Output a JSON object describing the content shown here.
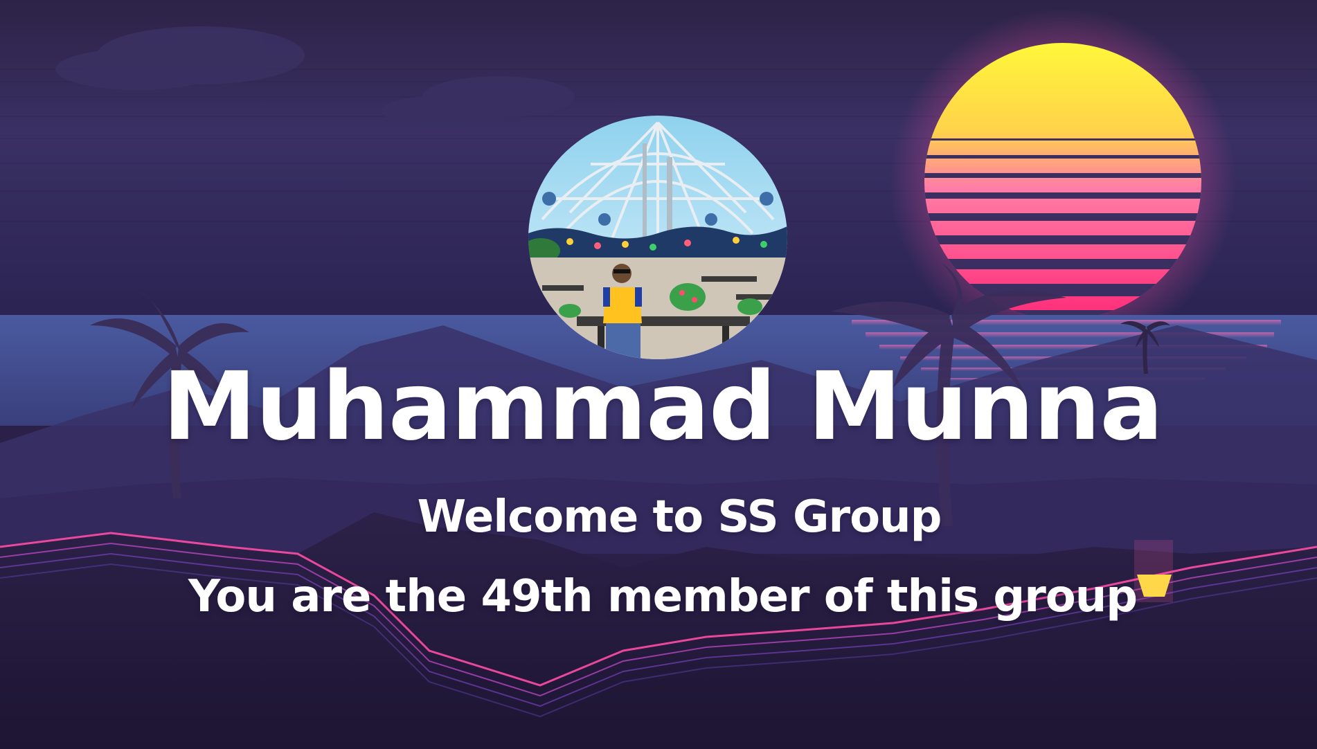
{
  "card": {
    "name": "Muhammad Munna",
    "welcome": "Welcome to SS Group",
    "member_line": "You are the 49th member of this group"
  },
  "theme": {
    "sky": "#2d2450",
    "sea": "#41508f",
    "sun_top": "#fff23a",
    "sun_bottom": "#ff2f7a",
    "text": "#ffffff"
  },
  "icons": {
    "avatar": "profile-photo-icon",
    "sun": "sun-icon",
    "palm": "palm-tree-icon"
  }
}
